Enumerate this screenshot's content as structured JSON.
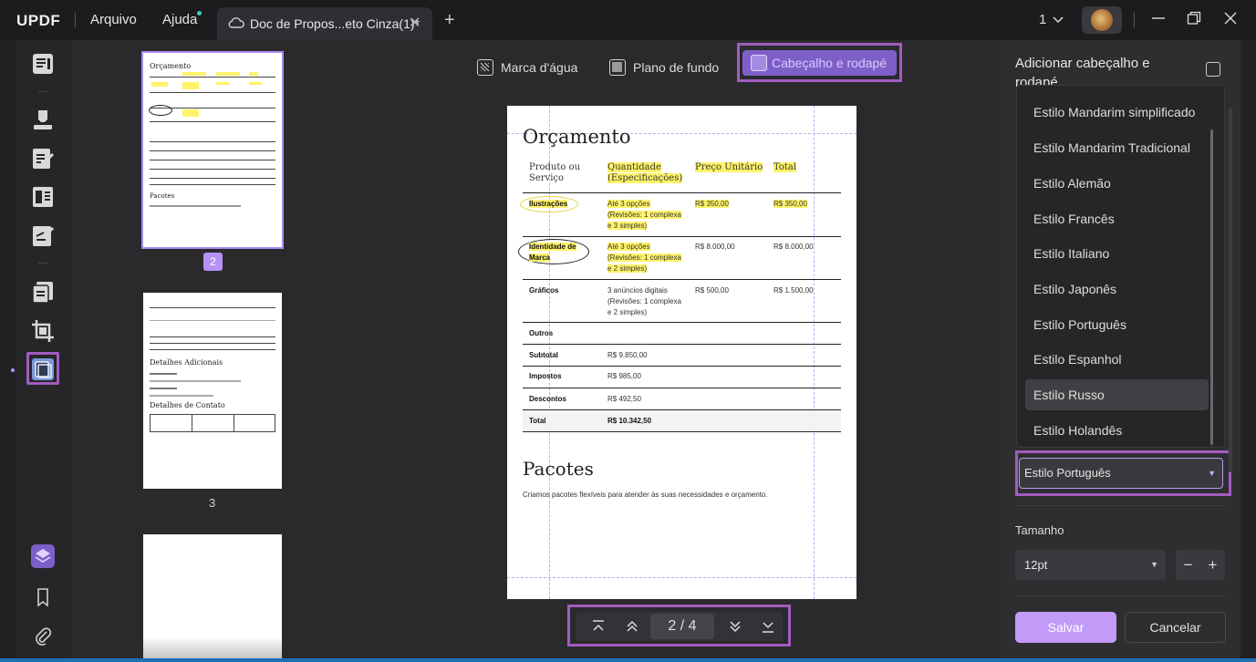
{
  "app": {
    "logo": "UPDF",
    "menu": [
      "Arquivo",
      "Ajuda"
    ],
    "tab_title": "Doc de Propos...eto Cinza(1)*",
    "page_selector": "1"
  },
  "tools": {
    "watermark": "Marca d'água",
    "background": "Plano de fundo",
    "header_footer": "Cabeçalho e rodapé"
  },
  "thumbnails": {
    "current_badge": "2",
    "page3_label": "3",
    "thumb2_title": "Orçamento",
    "thumb2_subtitle": "Pacotes",
    "thumb3_heading1": "Detalhes Adicionais",
    "thumb3_heading2": "Detalhes de Contato"
  },
  "document": {
    "title": "Orçamento",
    "headers": [
      "Produto ou Serviço",
      "Quantidade (Especificações)",
      "Preço Unitário",
      "Total"
    ],
    "rows": [
      {
        "name": "Ilustrações",
        "qty": [
          "Até 3 opções",
          "(Revisões: 1 complexa",
          "e 3 simples)"
        ],
        "unit": "R$ 350,00",
        "total": "R$ 350,00"
      },
      {
        "name_lines": [
          "Identidade de",
          "Marca"
        ],
        "qty": [
          "Até 3 opções",
          "(Revisões: 1 complexa",
          "e 2 simples)"
        ],
        "unit": "R$ 8.000,00",
        "total": "R$ 8.000,00"
      },
      {
        "name": "Gráficos",
        "qty": [
          "3 anúncios digitais",
          "(Revisões: 1 complexa",
          "e 2 simples)"
        ],
        "unit": "R$ 500,00",
        "total": "R$ 1.500,00"
      }
    ],
    "summary": [
      {
        "label": "Outros",
        "value": ""
      },
      {
        "label": "Subtotal",
        "value": "R$ 9.850,00"
      },
      {
        "label": "Impostos",
        "value": "R$ 985,00"
      },
      {
        "label": "Descontos",
        "value": "R$ 492,50"
      },
      {
        "label": "Total",
        "value": "R$ 10.342,50"
      }
    ],
    "section": "Pacotes",
    "section_text": "Criamos pacotes flexíveis para atender às suas necessidades e orçamento."
  },
  "navigation": {
    "current_page": "2",
    "separator": "/",
    "total_pages": "4"
  },
  "panel": {
    "title": "Adicionar cabeçalho e rodapé",
    "dropdown_options": [
      "Estilo Mandarim simplificado",
      "Estilo Mandarim Tradicional",
      "Estilo Alemão",
      "Estilo Francês",
      "Estilo Italiano",
      "Estilo Japonês",
      "Estilo Português",
      "Estilo Espanhol",
      "Estilo Russo",
      "Estilo Holandês"
    ],
    "hovered_option": "Estilo Russo",
    "selected_style": "Estilo Português",
    "size_label": "Tamanho",
    "size_value": "12pt",
    "minus": "−",
    "plus": "+",
    "save": "Salvar",
    "cancel": "Cancelar"
  },
  "colors": {
    "accent": "#b792f5",
    "highlight_box": "#a25bbf",
    "doc_highlight": "#fff36a"
  }
}
